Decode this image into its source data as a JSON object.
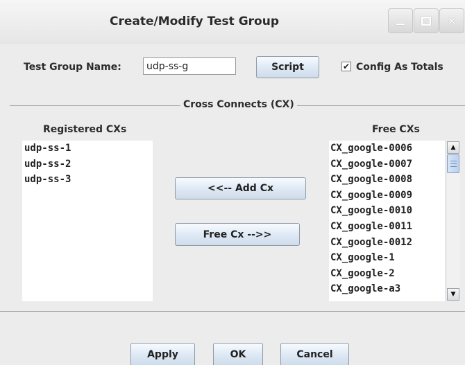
{
  "window": {
    "title": "Create/Modify Test Group",
    "controls": {
      "minimize_icon": "minimize-icon",
      "maximize_icon": "maximize-icon",
      "close_icon": "close-icon"
    }
  },
  "form": {
    "test_group_name_label": "Test Group Name:",
    "test_group_name_value": "udp-ss-g",
    "script_button": "Script",
    "config_as_totals_label": "Config As Totals",
    "config_as_totals_checked": true,
    "check_glyph": "✔"
  },
  "cross_connects": {
    "section_title": "Cross Connects (CX)",
    "registered_header": "Registered CXs",
    "free_header": "Free CXs",
    "registered": [
      "udp-ss-1",
      "udp-ss-2",
      "udp-ss-3"
    ],
    "free": [
      "CX_google-0006",
      "CX_google-0007",
      "CX_google-0008",
      "CX_google-0009",
      "CX_google-0010",
      "CX_google-0011",
      "CX_google-0012",
      "CX_google-1",
      "CX_google-2",
      "CX_google-a3"
    ],
    "add_button": "<<--  Add Cx",
    "free_button": "Free Cx -->>",
    "scroll_up_glyph": "▲",
    "scroll_down_glyph": "▼"
  },
  "footer": {
    "apply_button": "Apply",
    "ok_button": "OK",
    "cancel_button": "Cancel"
  }
}
